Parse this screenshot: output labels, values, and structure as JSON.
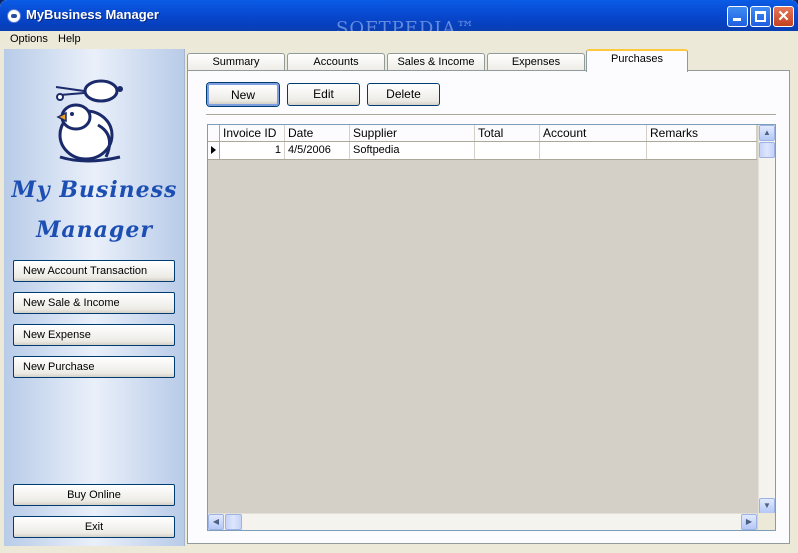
{
  "window": {
    "title": "MyBusiness Manager",
    "watermark": "SOFTPEDIA™",
    "controls": [
      "minimize-icon",
      "maximize-icon",
      "close-icon"
    ]
  },
  "menu": [
    "Options",
    "Help"
  ],
  "sidebar": {
    "logo_line1": "My Business",
    "logo_line2": "Manager",
    "buttons": [
      "New Account Transaction",
      "New Sale & Income",
      "New Expense",
      "New Purchase"
    ],
    "buy_online": "Buy Online",
    "exit": "Exit"
  },
  "tabs": [
    {
      "label": "Summary"
    },
    {
      "label": "Accounts"
    },
    {
      "label": "Sales & Income"
    },
    {
      "label": "Expenses"
    },
    {
      "label": "Purchases",
      "active": true
    }
  ],
  "actions": {
    "new": "New",
    "edit": "Edit",
    "delete": "Delete"
  },
  "grid": {
    "columns": [
      "Invoice ID",
      "Date",
      "Supplier",
      "Total",
      "Account",
      "Remarks"
    ],
    "rows": [
      [
        "1",
        "4/5/2006",
        "Softpedia",
        "",
        "",
        ""
      ]
    ]
  },
  "colors": {
    "title_bar": "#0a5ce6",
    "active_tab_accent": "#ffc83c",
    "logo_text": "#1d4fb3"
  }
}
